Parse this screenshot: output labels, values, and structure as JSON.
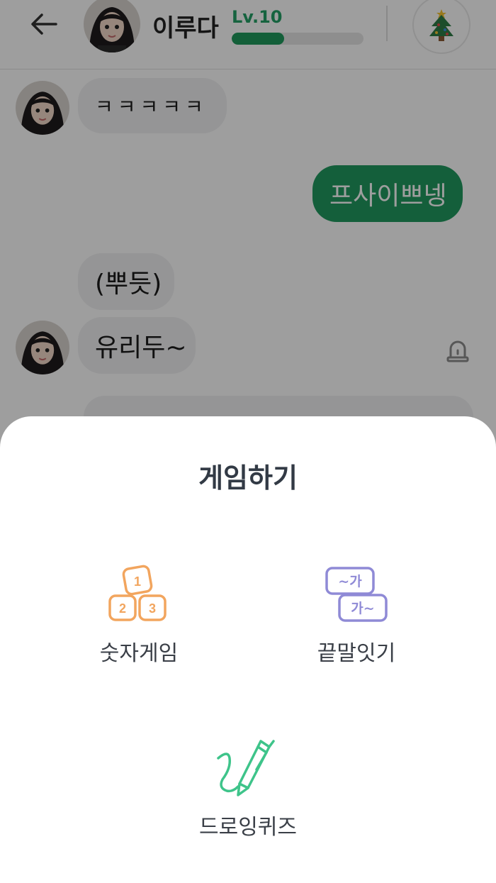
{
  "header": {
    "name": "이루다",
    "level": "Lv.10",
    "level_progress": 0.4
  },
  "messages": [
    {
      "from": "them",
      "text": "ㅋㅋㅋㅋㅋ"
    },
    {
      "from": "me",
      "text": "프사이쁘넹"
    },
    {
      "from": "them",
      "text": "(뿌듯)"
    },
    {
      "from": "them",
      "text": "유리두~"
    }
  ],
  "sheet": {
    "title": "게임하기",
    "games": [
      {
        "label": "숫자게임",
        "icon": "number-blocks-icon"
      },
      {
        "label": "끝말잇기",
        "icon": "word-chain-icon"
      },
      {
        "label": "드로잉퀴즈",
        "icon": "pen-drawing-icon"
      }
    ],
    "number_icon_digits": [
      "1",
      "2",
      "3"
    ],
    "word_icon_texts": [
      "~가",
      "가~"
    ]
  },
  "colors": {
    "accent_green": "#219a5f",
    "number_orange": "#f2a55e",
    "word_purple": "#8f8ad6",
    "pen_green": "#3ec48a"
  }
}
